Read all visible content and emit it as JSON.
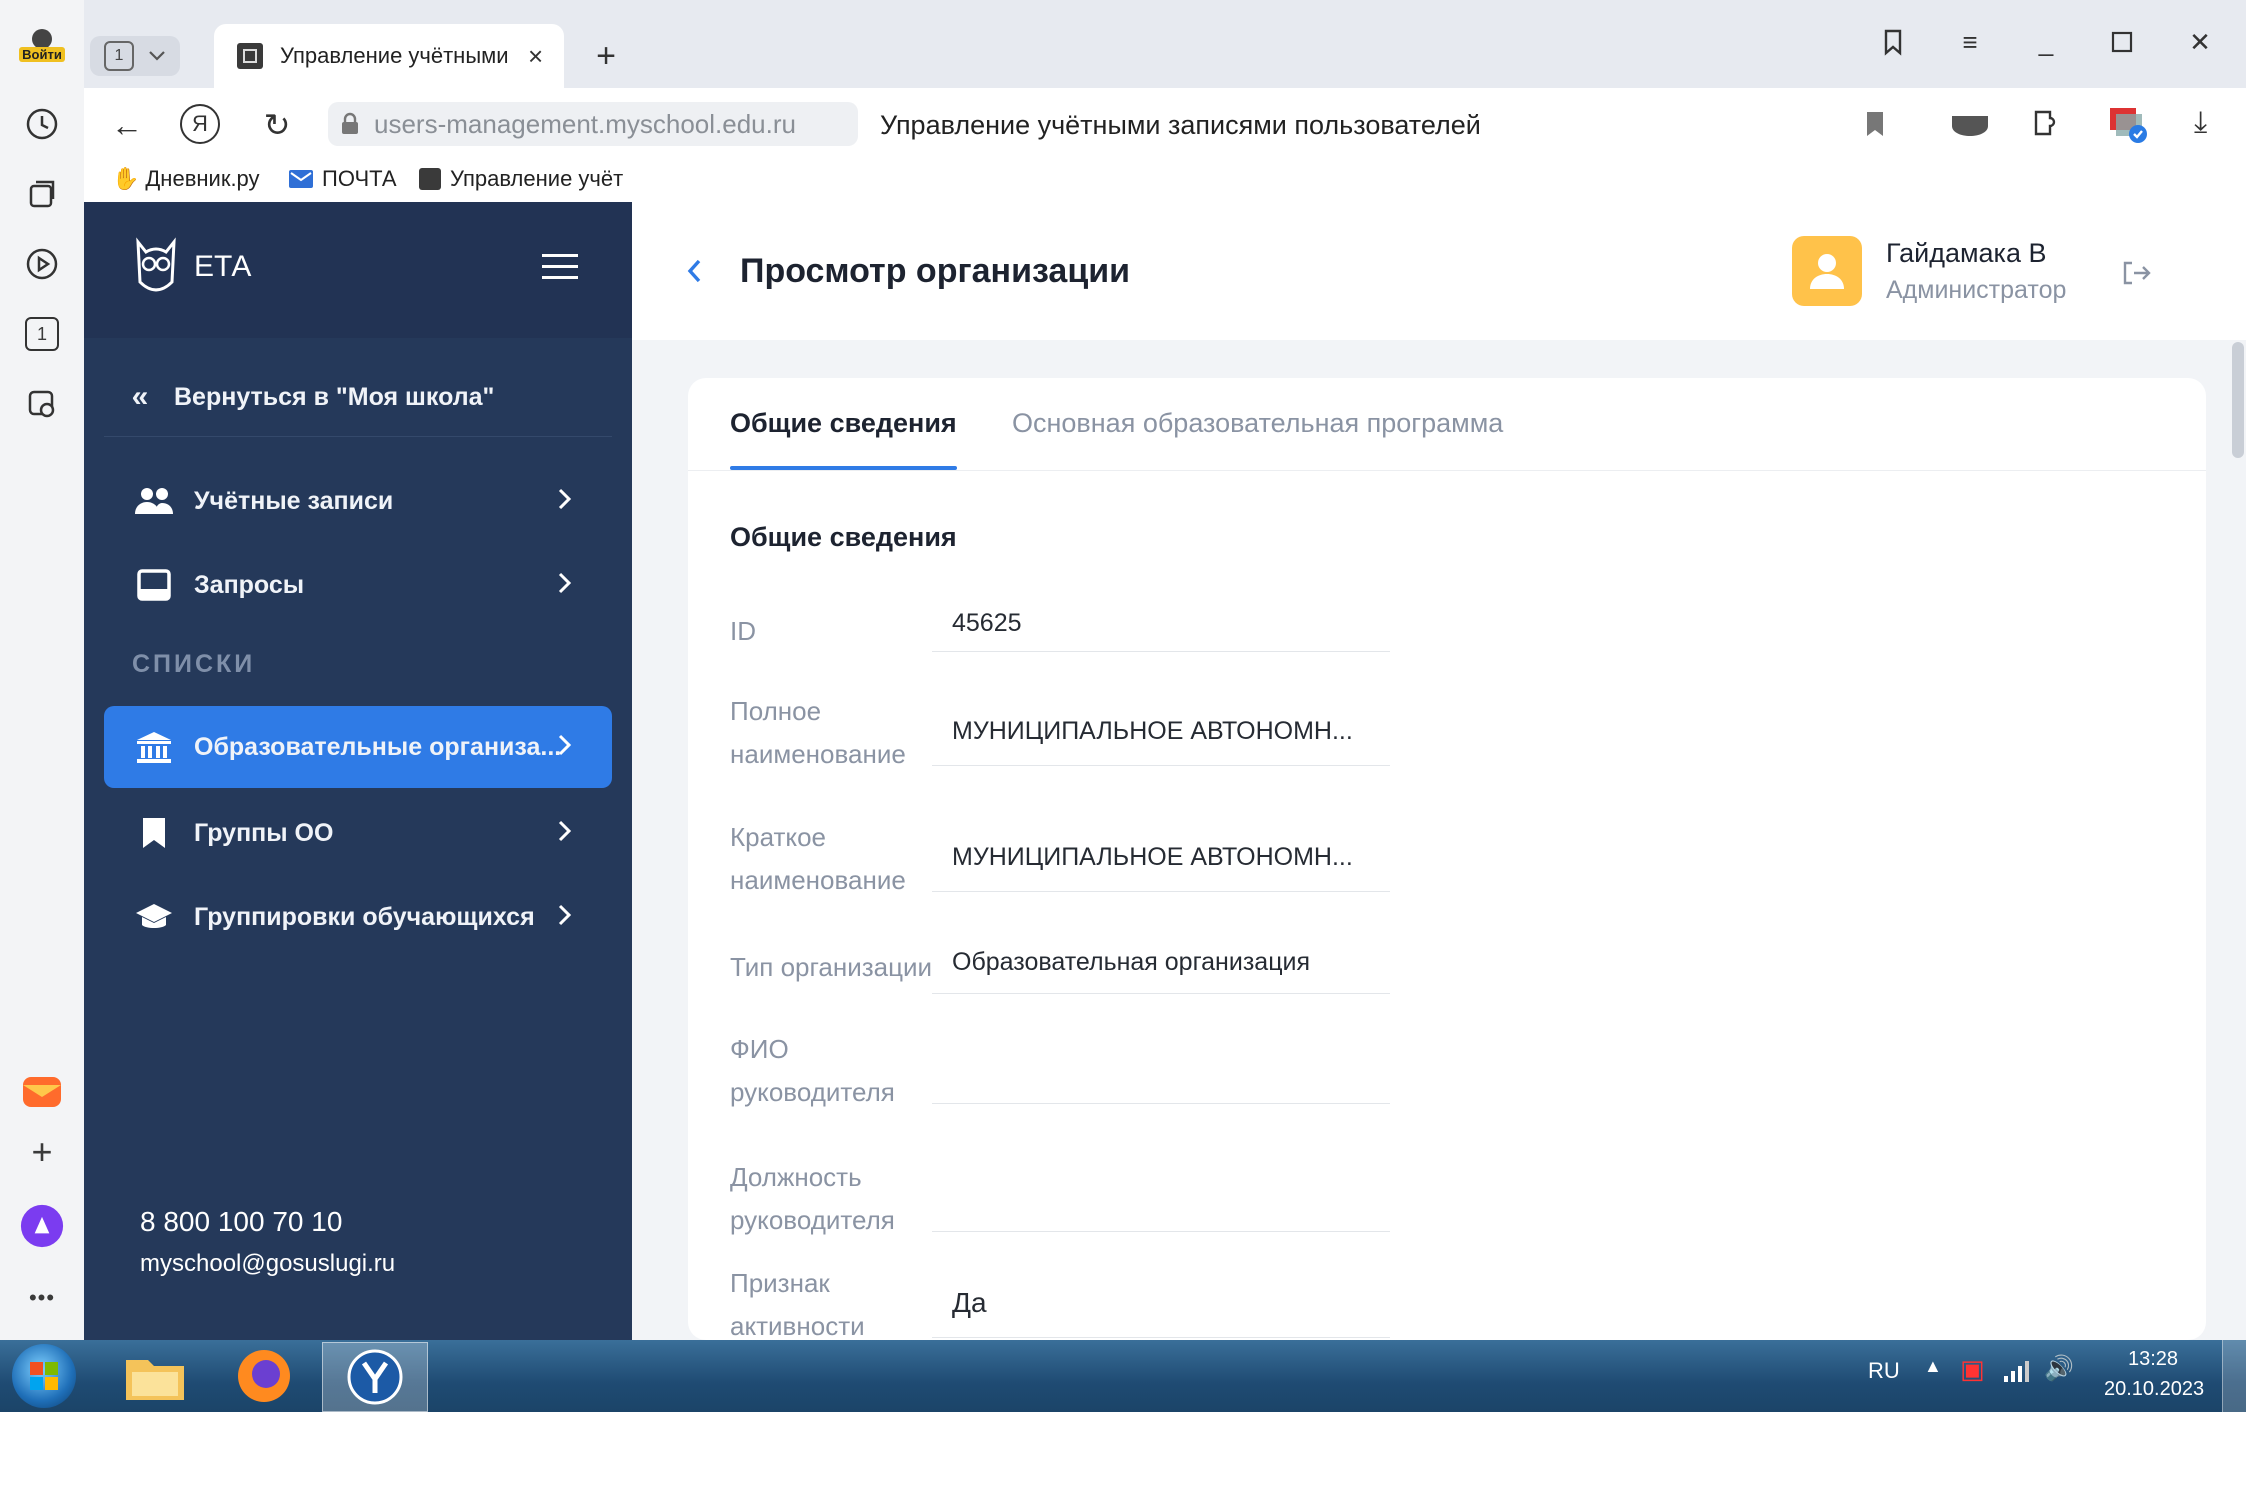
{
  "browser": {
    "login_label": "Войти",
    "tab_counter": "1",
    "tab_title": "Управление учётными",
    "url": "users-management.myschool.edu.ru",
    "page_title": "Управление учётными записями пользователей",
    "rail_counter": "1",
    "bookmarks": [
      {
        "label": "Дневник.ру"
      },
      {
        "label": "ПОЧТА"
      },
      {
        "label": "Управление учёт"
      }
    ]
  },
  "sidebar": {
    "logo_text": "ЕТА",
    "back_label": "Вернуться в \"Моя школа\"",
    "items": [
      {
        "label": "Учётные записи"
      },
      {
        "label": "Запросы"
      }
    ],
    "section_title": "СПИСКИ",
    "list_items": [
      {
        "label": "Образовательные организа..."
      },
      {
        "label": "Группы ОО"
      },
      {
        "label": "Группировки обучающихся"
      }
    ],
    "phone": "8 800 100 70 10",
    "email": "myschool@gosuslugi.ru"
  },
  "header": {
    "title": "Просмотр организации",
    "user_name": "Гайдамака В",
    "user_role": "Администратор"
  },
  "tabs": [
    {
      "label": "Общие сведения",
      "active": true
    },
    {
      "label": "Основная образовательная программа",
      "active": false
    }
  ],
  "section": {
    "title": "Общие сведения",
    "fields": [
      {
        "label": "ID",
        "value": "45625"
      },
      {
        "label": "Полное наименование",
        "value": "МУНИЦИПАЛЬНОЕ АВТОНОМН..."
      },
      {
        "label": "Краткое наименование",
        "value": "МУНИЦИПАЛЬНОЕ АВТОНОМН..."
      },
      {
        "label": "Тип организации",
        "value": "Образовательная организация"
      },
      {
        "label": "ФИО руководителя",
        "value": ""
      },
      {
        "label": "Должность руководителя",
        "value": ""
      },
      {
        "label": "Признак активности",
        "value": "Да"
      }
    ]
  },
  "taskbar": {
    "lang": "RU",
    "time": "13:28",
    "date": "20.10.2023"
  },
  "colors": {
    "sidebar_bg": "#25395a",
    "accent": "#2f7be6",
    "avatar": "#ffc24a"
  }
}
